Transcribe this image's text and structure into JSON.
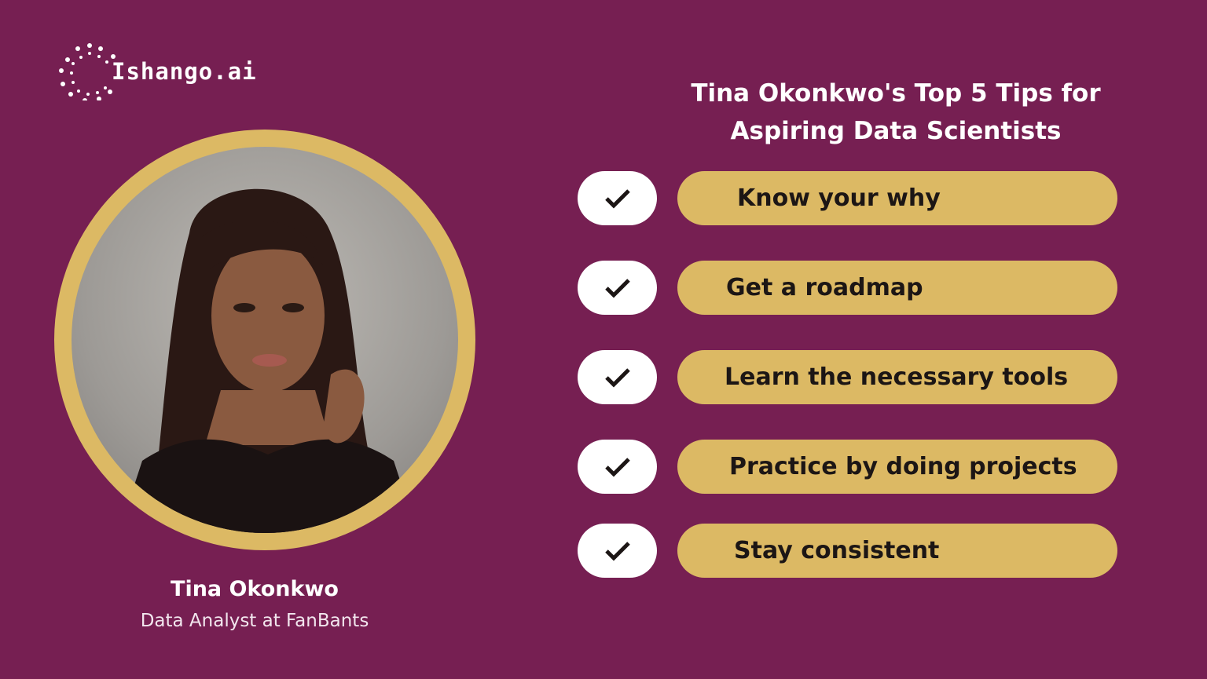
{
  "brand": {
    "name": "Ishango.ai",
    "logo_icon": "dotted-circle-logo-icon"
  },
  "header": {
    "title_line1": "Tina Okonkwo's Top 5 Tips for",
    "title_line2": "Aspiring Data Scientists"
  },
  "profile": {
    "name": "Tina Okonkwo",
    "role": "Data Analyst at FanBants",
    "photo": "portrait-photo"
  },
  "tips": [
    {
      "icon": "check-icon",
      "label": "Know your why"
    },
    {
      "icon": "check-icon",
      "label": "Get a roadmap"
    },
    {
      "icon": "check-icon",
      "label": "Learn the necessary tools"
    },
    {
      "icon": "check-icon",
      "label": "Practice by doing projects"
    },
    {
      "icon": "check-icon",
      "label": "Stay consistent"
    }
  ],
  "colors": {
    "background": "#761f52",
    "accent": "#dcb964",
    "check_bg": "#ffffff",
    "text_dark": "#1c1615"
  }
}
